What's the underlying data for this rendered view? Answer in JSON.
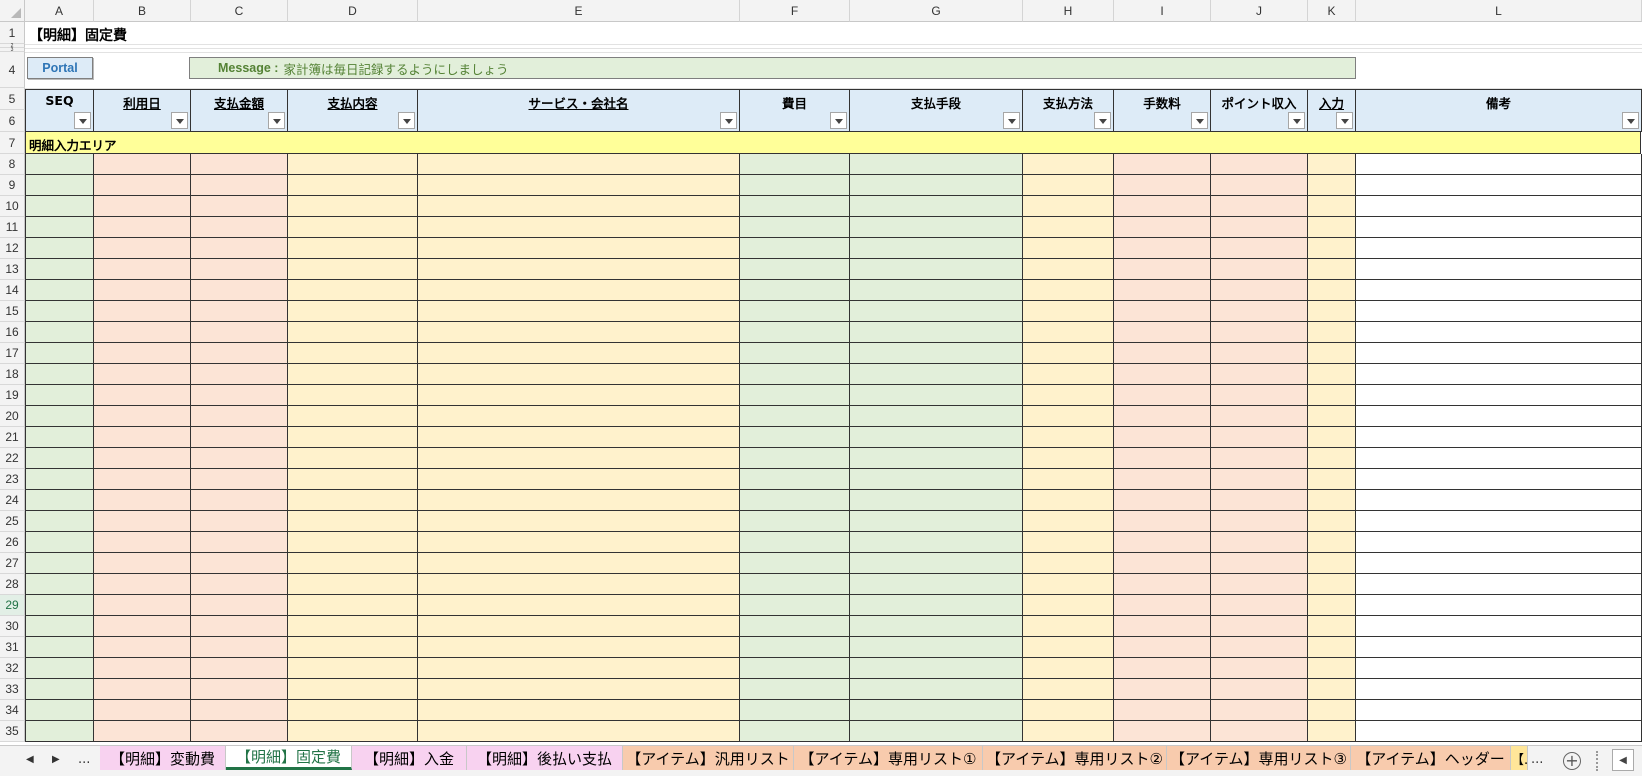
{
  "columns": [
    "A",
    "B",
    "C",
    "D",
    "E",
    "F",
    "G",
    "H",
    "I",
    "J",
    "K",
    "L"
  ],
  "rows": [
    "1",
    "2",
    "3",
    "4",
    "5",
    "6",
    "7",
    "8",
    "9",
    "10",
    "11",
    "12",
    "13",
    "14",
    "15",
    "16",
    "17",
    "18",
    "19",
    "20",
    "21",
    "22",
    "23",
    "24",
    "25",
    "26",
    "27",
    "28",
    "29",
    "30",
    "31",
    "32",
    "33",
    "34",
    "35"
  ],
  "selected_row": "29",
  "sheet_title": "【明細】固定費",
  "portal_button": "Portal",
  "message": {
    "label": "Message :",
    "text": "家計簿は毎日記録するようにしましょう"
  },
  "table_headers": [
    "SEQ",
    "利用日",
    "支払金額",
    "支払内容",
    "サービス・会社名",
    "費目",
    "支払手段",
    "支払方法",
    "手数料",
    "ポイント収入",
    "入力",
    "備考"
  ],
  "input_area_label": "明細入力エリア",
  "colors": {
    "header_fill": "#ddebf7",
    "green_fill": "#e2efda",
    "pink_fill": "#fce4d6",
    "yellow_fill": "#fff2cc",
    "input_band": "#ffff99",
    "message_fill": "#e2efda",
    "active_tab_text": "#217346",
    "tab_magenta": "#f8d2f0",
    "tab_orange": "#f8cbad"
  },
  "sheet_tabs": [
    {
      "label": "【明細】変動費",
      "active": false
    },
    {
      "label": "【明細】固定費",
      "active": true
    },
    {
      "label": "【明細】入金",
      "active": false
    },
    {
      "label": "【明細】後払い支払",
      "active": false
    },
    {
      "label": "【アイテム】汎用リスト",
      "active": false
    },
    {
      "label": "【アイテム】専用リスト①",
      "active": false
    },
    {
      "label": "【アイテム】専用リスト②",
      "active": false
    },
    {
      "label": "【アイテム】専用リスト③",
      "active": false
    },
    {
      "label": "【アイテム】ヘッダー",
      "active": false
    },
    {
      "label": "【...",
      "active": false
    }
  ],
  "tab_nav": {
    "prev": "◀",
    "next": "▶",
    "more": "...",
    "more_right": "...",
    "add": "+",
    "scroll_left": "◀"
  },
  "icons": {
    "filter": "filter-dropdown-icon",
    "add_sheet": "plus-circle-icon",
    "prev": "triangle-left-icon",
    "next": "triangle-right-icon"
  }
}
